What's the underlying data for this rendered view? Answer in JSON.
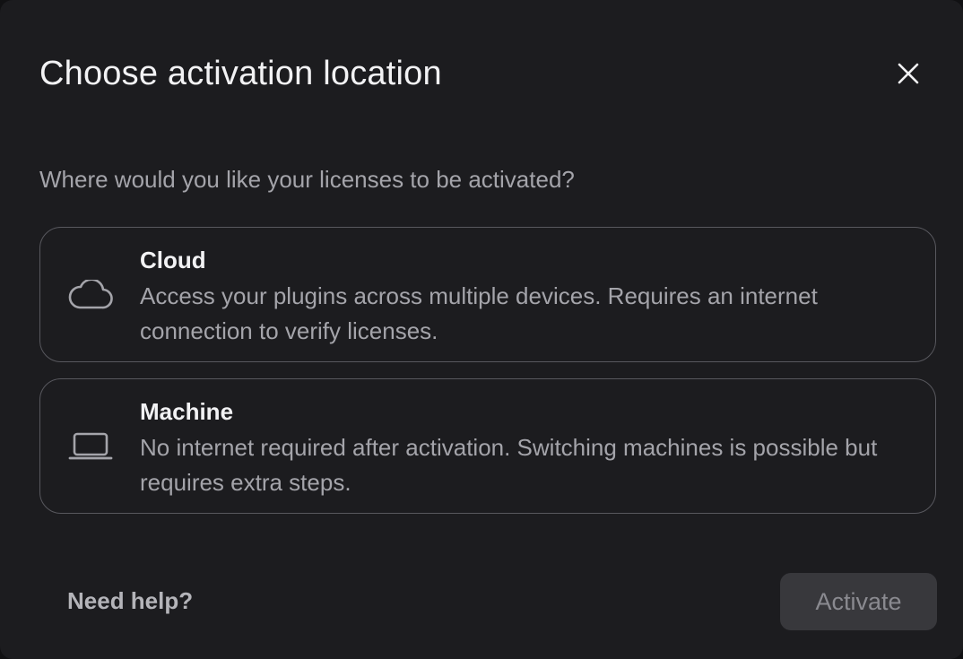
{
  "dialog": {
    "title": "Choose activation location",
    "close_icon": "close-icon",
    "question": "Where would you like your licenses to be activated?",
    "options": [
      {
        "icon": "cloud-icon",
        "title": "Cloud",
        "description": "Access your plugins across multiple devices. Requires an internet connection to verify licenses."
      },
      {
        "icon": "laptop-icon",
        "title": "Machine",
        "description": "No internet required after activation. Switching machines is possible but requires extra steps."
      }
    ],
    "help_label": "Need help?",
    "activate_label": "Activate",
    "activate_enabled": false
  },
  "colors": {
    "background": "#1c1c1f",
    "text_primary": "#f2f2f4",
    "text_secondary": "#a4a4aa",
    "border": "#58585e",
    "button_disabled_bg": "#38383c",
    "button_disabled_text": "#8a8a90"
  }
}
